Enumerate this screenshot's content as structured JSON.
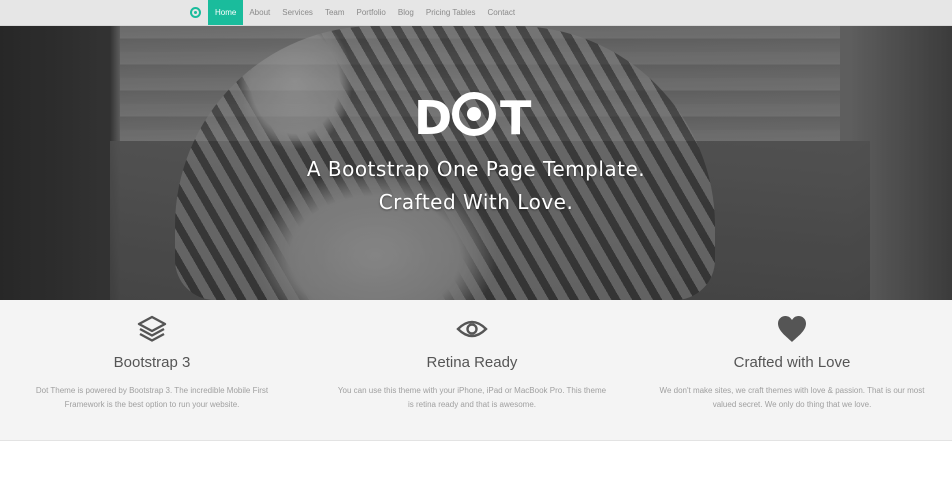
{
  "nav": {
    "items": [
      {
        "label": "Home",
        "active": true
      },
      {
        "label": "About"
      },
      {
        "label": "Services"
      },
      {
        "label": "Team"
      },
      {
        "label": "Portfolio"
      },
      {
        "label": "Blog"
      },
      {
        "label": "Pricing Tables"
      },
      {
        "label": "Contact"
      }
    ]
  },
  "hero": {
    "logo_text": "DOT",
    "tagline_line1": "A Bootstrap One Page Template.",
    "tagline_line2": "Crafted With Love."
  },
  "features": [
    {
      "icon": "layers-icon",
      "title": "Bootstrap 3",
      "text": "Dot Theme is powered by Bootstrap 3. The incredible Mobile First Framework is the best option to run your website."
    },
    {
      "icon": "eye-icon",
      "title": "Retina Ready",
      "text": "You can use this theme with your iPhone, iPad or MacBook Pro. This theme is retina ready and that is awesome."
    },
    {
      "icon": "heart-icon",
      "title": "Crafted with Love",
      "text": "We don't make sites, we craft themes with love & passion. That is our most valued secret. We only do thing that we love."
    }
  ],
  "colors": {
    "accent": "#1abc9c",
    "nav_bg": "#e6e6e6",
    "feature_bg": "#f4f4f4",
    "icon": "#555555"
  }
}
